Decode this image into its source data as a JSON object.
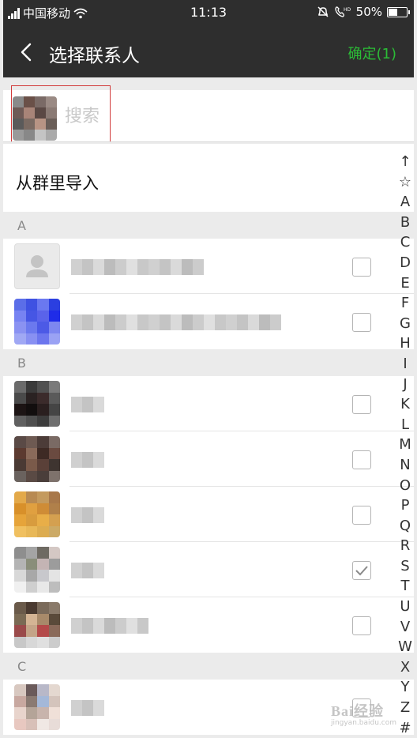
{
  "status_bar": {
    "carrier": "中国移动",
    "time": "11:13",
    "battery": "50%",
    "battery_level": 0.5
  },
  "nav": {
    "title": "选择联系人",
    "confirm_label": "确定(1)",
    "confirm_color": "#2bbc36"
  },
  "search": {
    "placeholder": "搜索",
    "highlight_color": "#d23b3b"
  },
  "import": {
    "label": "从群里导入"
  },
  "sections": [
    {
      "letter": "A",
      "contacts": [
        {
          "avatar": "default-avatar-icon",
          "checked": false
        },
        {
          "avatar": "blue-pixel-avatar",
          "checked": false
        }
      ]
    },
    {
      "letter": "B",
      "contacts": [
        {
          "avatar": "dark-pixel-avatar",
          "checked": false
        },
        {
          "avatar": "brown-pixel-avatar",
          "checked": false
        },
        {
          "avatar": "orange-pixel-avatar",
          "checked": false
        },
        {
          "avatar": "gray-pixel-avatar",
          "checked": true
        },
        {
          "avatar": "red-pixel-avatar",
          "checked": false
        }
      ]
    },
    {
      "letter": "C",
      "contacts": [
        {
          "avatar": "pink-pixel-avatar",
          "checked": false
        }
      ]
    }
  ],
  "index_bar": [
    "↑",
    "☆",
    "A",
    "B",
    "C",
    "D",
    "E",
    "F",
    "G",
    "H",
    "I",
    "J",
    "K",
    "L",
    "M",
    "N",
    "O",
    "P",
    "Q",
    "R",
    "S",
    "T",
    "U",
    "V",
    "W",
    "X",
    "Y",
    "Z",
    "#"
  ],
  "watermark": {
    "text": "Bai经验",
    "subtext": "jingyan.baidu.com"
  }
}
